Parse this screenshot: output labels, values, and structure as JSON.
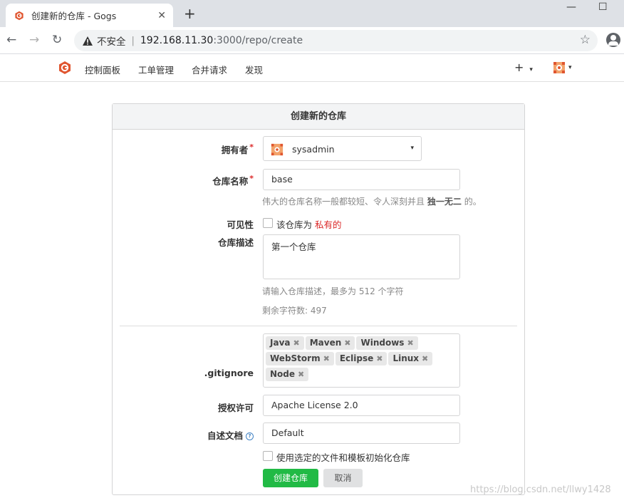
{
  "browser": {
    "tab_title": "创建新的仓库 - Gogs",
    "tab_close": "✕",
    "new_tab": "+",
    "win_min": "—",
    "win_max": "☐",
    "back": "←",
    "forward": "→",
    "reload": "↻",
    "insecure_label": "不安全",
    "url_host": "192.168.11.30",
    "url_path": ":3000/repo/create",
    "bookmark": "☆"
  },
  "header": {
    "nav": [
      "控制面板",
      "工单管理",
      "合并请求",
      "发现"
    ],
    "plus": "+",
    "caret": "▾"
  },
  "form": {
    "title": "创建新的仓库",
    "owner_label": "拥有者",
    "owner_value": "sysadmin",
    "required_mark": "*",
    "repo_name_label": "仓库名称",
    "repo_name_value": "base",
    "repo_name_hint_pre": "伟大的仓库名称一般都较短、令人深刻并且",
    "repo_name_hint_bold": "独一无二",
    "repo_name_hint_post": "的。",
    "visibility_label": "可见性",
    "visibility_text_pre": "该仓库为",
    "visibility_text_private": "私有的",
    "desc_label": "仓库描述",
    "desc_value": "第一个仓库",
    "desc_hint": "请输入仓库描述，最多为 512 个字符",
    "desc_remaining": "剩余字符数: 497",
    "gitignore_label": ".gitignore",
    "gitignore_tags": [
      "Java",
      "Maven",
      "Windows",
      "WebStorm",
      "Eclipse",
      "Linux",
      "Node"
    ],
    "tag_remove": "✖",
    "license_label": "授权许可",
    "license_value": "Apache License 2.0",
    "readme_label": "自述文档",
    "readme_help": "?",
    "readme_value": "Default",
    "auto_init_text": "使用选定的文件和模板初始化仓库",
    "create_button": "创建仓库",
    "cancel_button": "取消"
  },
  "watermark": "https://blog.csdn.net/llwy1428",
  "colors": {
    "primary_green": "#21ba45",
    "required_red": "#db2828",
    "gogs_orange": "#e0552f"
  }
}
